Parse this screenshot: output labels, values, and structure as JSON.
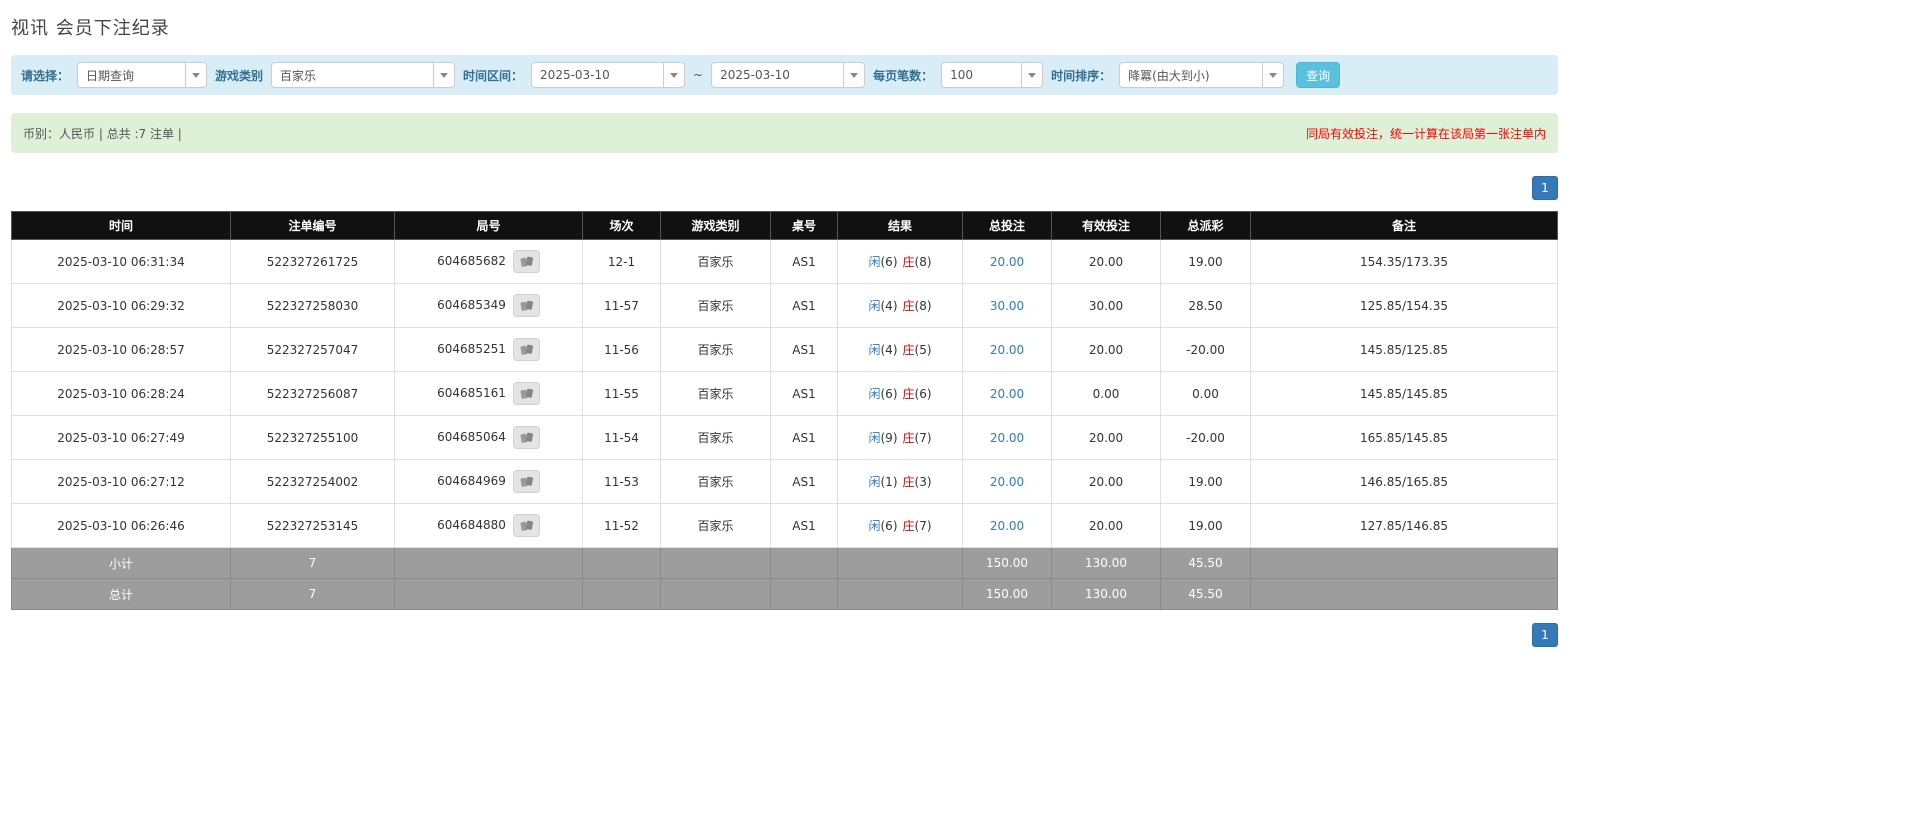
{
  "page": {
    "title": "视讯 会员下注纪录"
  },
  "filters": {
    "select_label": "请选择：",
    "select_value": "日期查询",
    "game_label": "游戏类别",
    "game_value": "百家乐",
    "range_label": "时间区间：",
    "date_from": "2025-03-10",
    "range_separator": "~",
    "date_to": "2025-03-10",
    "page_size_label": "每页笔数：",
    "page_size_value": "100",
    "sort_label": "时间排序：",
    "sort_value": "降冪(由大到小)",
    "search_button": "查询"
  },
  "summary": {
    "info": "币别：人民币 | 总共 :7 注单 |",
    "notice": "同局有效投注，统一计算在该局第一张注单内"
  },
  "pagination": {
    "current_page": "1"
  },
  "icons": {
    "dropdown": "chevron-down-icon",
    "round_preview": "cards-icon"
  },
  "colors": {
    "filter_bar_bg": "#d9edf7",
    "summary_bar_bg": "#dff0d8",
    "notice_red": "#ff0000",
    "header_bg": "#111111",
    "footer_bg": "#9d9d9d",
    "link_blue": "#337ab7",
    "banker_red": "#e60000",
    "search_button_bg": "#5bc0de",
    "pagination_bg": "#337ab7"
  },
  "table": {
    "headers": [
      "时间",
      "注单编号",
      "局号",
      "场次",
      "游戏类别",
      "桌号",
      "结果",
      "总投注",
      "有效投注",
      "总派彩",
      "备注"
    ],
    "rows": [
      {
        "time": "2025-03-10 06:31:34",
        "bet_id": "522327261725",
        "round_id": "604685682",
        "session": "12-1",
        "game": "百家乐",
        "table_no": "AS1",
        "player": "闲(6)",
        "banker": "庄(8)",
        "total_bet": "20.00",
        "valid_bet": "20.00",
        "payout": "19.00",
        "note": "154.35/173.35"
      },
      {
        "time": "2025-03-10 06:29:32",
        "bet_id": "522327258030",
        "round_id": "604685349",
        "session": "11-57",
        "game": "百家乐",
        "table_no": "AS1",
        "player": "闲(4)",
        "banker": "庄(8)",
        "total_bet": "30.00",
        "valid_bet": "30.00",
        "payout": "28.50",
        "note": "125.85/154.35"
      },
      {
        "time": "2025-03-10 06:28:57",
        "bet_id": "522327257047",
        "round_id": "604685251",
        "session": "11-56",
        "game": "百家乐",
        "table_no": "AS1",
        "player": "闲(4)",
        "banker": "庄(5)",
        "total_bet": "20.00",
        "valid_bet": "20.00",
        "payout": "-20.00",
        "note": "145.85/125.85"
      },
      {
        "time": "2025-03-10 06:28:24",
        "bet_id": "522327256087",
        "round_id": "604685161",
        "session": "11-55",
        "game": "百家乐",
        "table_no": "AS1",
        "player": "闲(6)",
        "banker": "庄(6)",
        "total_bet": "20.00",
        "valid_bet": "0.00",
        "payout": "0.00",
        "note": "145.85/145.85"
      },
      {
        "time": "2025-03-10 06:27:49",
        "bet_id": "522327255100",
        "round_id": "604685064",
        "session": "11-54",
        "game": "百家乐",
        "table_no": "AS1",
        "player": "闲(9)",
        "banker": "庄(7)",
        "total_bet": "20.00",
        "valid_bet": "20.00",
        "payout": "-20.00",
        "note": "165.85/145.85"
      },
      {
        "time": "2025-03-10 06:27:12",
        "bet_id": "522327254002",
        "round_id": "604684969",
        "session": "11-53",
        "game": "百家乐",
        "table_no": "AS1",
        "player": "闲(1)",
        "banker": "庄(3)",
        "total_bet": "20.00",
        "valid_bet": "20.00",
        "payout": "19.00",
        "note": "146.85/165.85"
      },
      {
        "time": "2025-03-10 06:26:46",
        "bet_id": "522327253145",
        "round_id": "604684880",
        "session": "11-52",
        "game": "百家乐",
        "table_no": "AS1",
        "player": "闲(6)",
        "banker": "庄(7)",
        "total_bet": "20.00",
        "valid_bet": "20.00",
        "payout": "19.00",
        "note": "127.85/146.85"
      }
    ],
    "footer_rows": [
      {
        "label": "小计",
        "count": "7",
        "total_bet": "150.00",
        "valid_bet": "130.00",
        "payout": "45.50"
      },
      {
        "label": "总计",
        "count": "7",
        "total_bet": "150.00",
        "valid_bet": "130.00",
        "payout": "45.50"
      }
    ]
  }
}
